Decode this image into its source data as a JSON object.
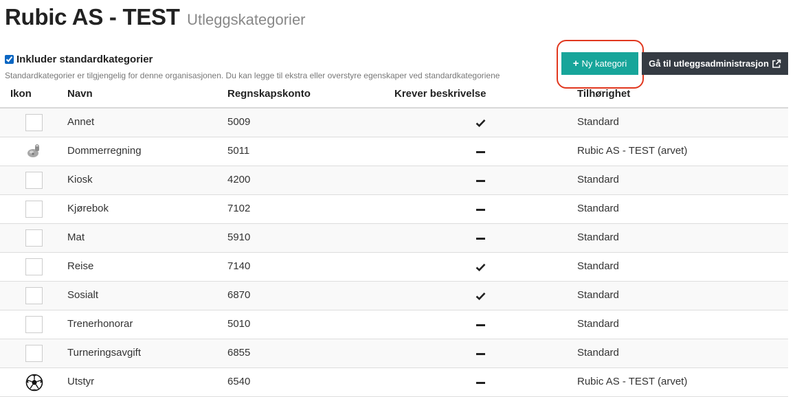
{
  "header": {
    "org_name": "Rubic AS - TEST",
    "subtitle": "Utleggskategorier"
  },
  "options": {
    "include_label": "Inkluder standardkategorier",
    "include_checked": true,
    "help_text": "Standardkategorier er tilgjengelig for denne organisasjonen. Du kan legge til ekstra eller overstyre egenskaper ved standardkategoriene"
  },
  "actions": {
    "new_label": "Ny kategori",
    "admin_label": "Gå til utleggsadministrasjon"
  },
  "colors": {
    "primary": "#17a59a",
    "dark": "#353b43",
    "highlight": "#e1371e"
  },
  "table": {
    "headers": {
      "icon": "Ikon",
      "name": "Navn",
      "account": "Regnskapskonto",
      "requires_description": "Krever beskrivelse",
      "belongs": "Tilhørighet"
    },
    "rows": [
      {
        "icon": "placeholder",
        "name": "Annet",
        "account": "5009",
        "requires": true,
        "belongs": "Standard"
      },
      {
        "icon": "whistle-icon",
        "name": "Dommerregning",
        "account": "5011",
        "requires": false,
        "belongs": "Rubic AS - TEST (arvet)"
      },
      {
        "icon": "placeholder",
        "name": "Kiosk",
        "account": "4200",
        "requires": false,
        "belongs": "Standard"
      },
      {
        "icon": "placeholder",
        "name": "Kjørebok",
        "account": "7102",
        "requires": false,
        "belongs": "Standard"
      },
      {
        "icon": "placeholder",
        "name": "Mat",
        "account": "5910",
        "requires": false,
        "belongs": "Standard"
      },
      {
        "icon": "placeholder",
        "name": "Reise",
        "account": "7140",
        "requires": true,
        "belongs": "Standard"
      },
      {
        "icon": "placeholder",
        "name": "Sosialt",
        "account": "6870",
        "requires": true,
        "belongs": "Standard"
      },
      {
        "icon": "placeholder",
        "name": "Trenerhonorar",
        "account": "5010",
        "requires": false,
        "belongs": "Standard"
      },
      {
        "icon": "placeholder",
        "name": "Turneringsavgift",
        "account": "6855",
        "requires": false,
        "belongs": "Standard"
      },
      {
        "icon": "soccer-ball-icon",
        "name": "Utstyr",
        "account": "6540",
        "requires": false,
        "belongs": "Rubic AS - TEST (arvet)"
      }
    ]
  }
}
